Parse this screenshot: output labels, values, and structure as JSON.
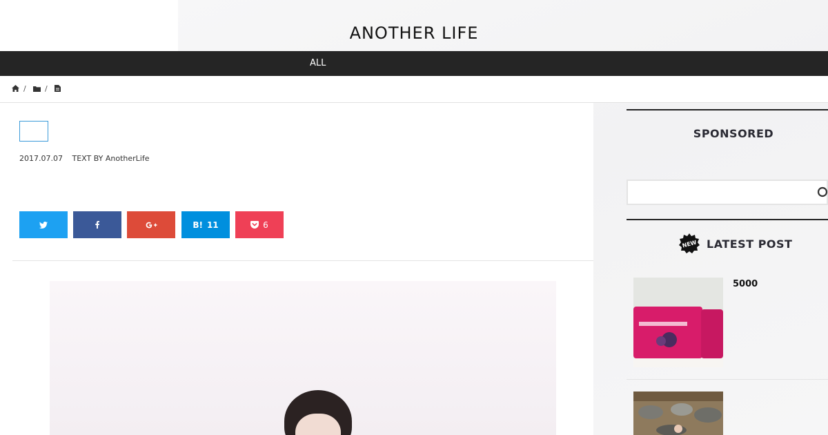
{
  "site": {
    "title": "ANOTHER LIFE"
  },
  "nav": {
    "items": [
      {
        "label": "ALL"
      }
    ]
  },
  "breadcrumb": {
    "separator": "/",
    "icons": [
      "home-icon",
      "folder-icon",
      "document-icon"
    ]
  },
  "article": {
    "date": "2017.07.07",
    "author": "TEXT BY AnotherLife",
    "share": {
      "twitter_icon": "twitter-icon",
      "facebook_icon": "facebook-icon",
      "googleplus_icon": "googleplus-icon",
      "hatena_label": "B!",
      "hatena_count": "11",
      "pocket_icon": "pocket-icon",
      "pocket_count": "6"
    },
    "hero_image": "portrait-photo"
  },
  "sidebar": {
    "sponsored_title": "SPONSORED",
    "search": {
      "placeholder": "",
      "icon": "search-icon"
    },
    "latest": {
      "title": "LATEST POST",
      "badge_icon": "new-badge-icon",
      "posts": [
        {
          "title": "5000",
          "image": "product-photo"
        },
        {
          "title": "",
          "image": "garden-photo"
        }
      ]
    }
  },
  "colors": {
    "nav_bg": "#252525",
    "twitter": "#1da1f2",
    "facebook": "#3b5998",
    "googleplus": "#dd4b39",
    "hatena": "#008fde",
    "pocket": "#ef4056",
    "tag_border": "#3a9ad9"
  }
}
